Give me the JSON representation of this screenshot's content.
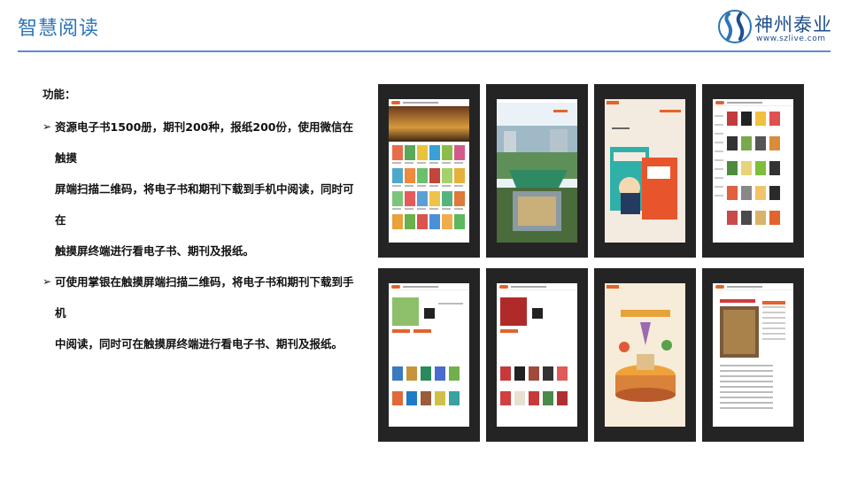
{
  "slide": {
    "title": "智慧阅读"
  },
  "logo": {
    "name": "神州泰业",
    "url": "www.szlive.com"
  },
  "content": {
    "heading": "功能：",
    "bullets": [
      {
        "line1": "资源电子书1500册，期刊200种，报纸200份，使用微信在触摸",
        "line2": "屏端扫描二维码，将电子书和期刊下载到手机中阅读，同时可在",
        "line3": "触摸屏终端进行看电子书、期刊及报纸。"
      },
      {
        "line1": "可使用掌银在触摸屏端扫描二维码，将电子书和期刊下载到手机",
        "line2": "中阅读，同时可在触摸屏终端进行看电子书、期刊及报纸。"
      }
    ]
  },
  "colors": {
    "title": "#2e75b6",
    "rule": "#5b8ccc",
    "brand_orange": "#e2632b",
    "device_frame": "#242424"
  }
}
